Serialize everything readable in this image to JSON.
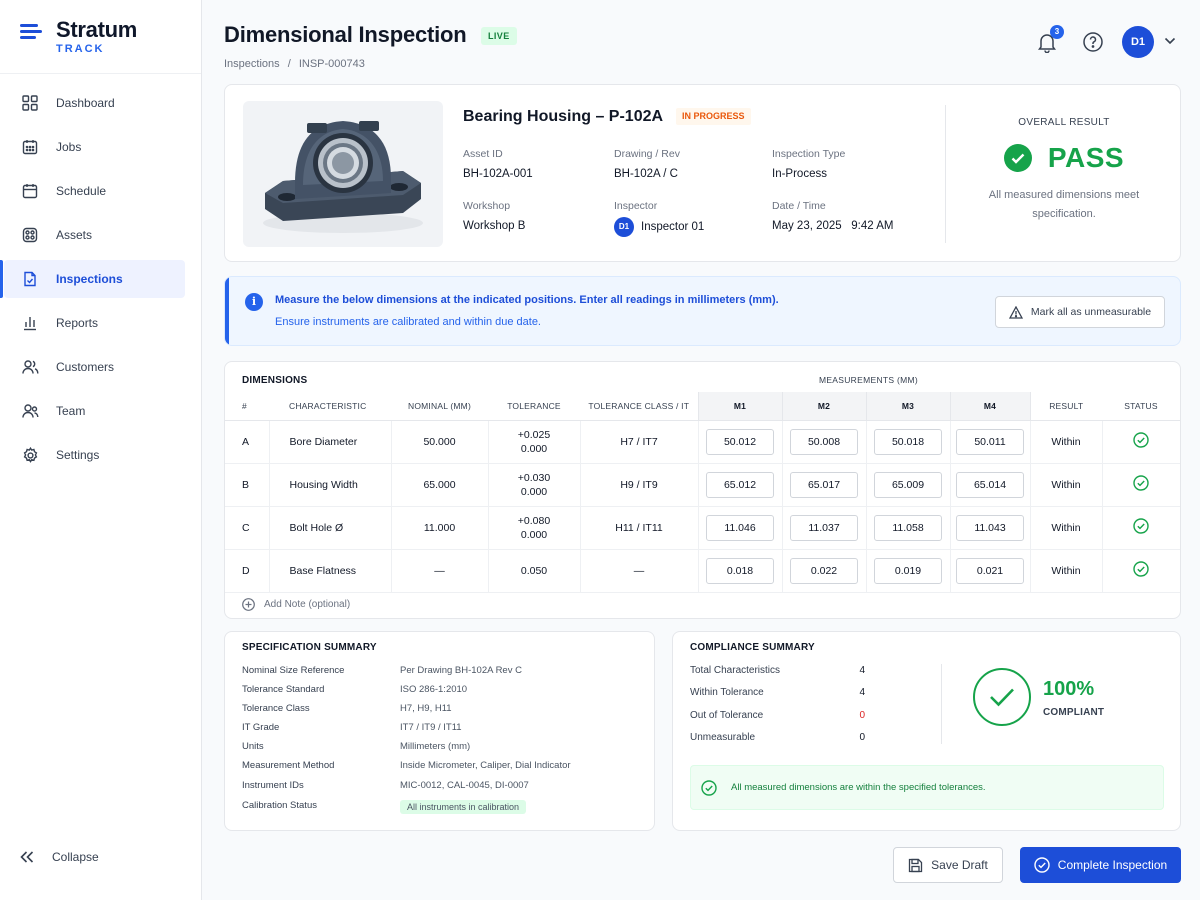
{
  "brand": {
    "name": "Stratum",
    "sub": "TRACK"
  },
  "nav": [
    {
      "label": "Dashboard",
      "icon": "grid-icon"
    },
    {
      "label": "Jobs",
      "icon": "calendar-grid-icon"
    },
    {
      "label": "Schedule",
      "icon": "calendar-icon"
    },
    {
      "label": "Assets",
      "icon": "assets-icon"
    },
    {
      "label": "Inspections",
      "icon": "clipboard-check-icon",
      "active": true
    },
    {
      "label": "Reports",
      "icon": "bar-chart-icon"
    },
    {
      "label": "Customers",
      "icon": "users-icon"
    },
    {
      "label": "Team",
      "icon": "team-icon"
    },
    {
      "label": "Settings",
      "icon": "gear-icon"
    }
  ],
  "collapse_label": "Collapse",
  "header": {
    "title": "Dimensional Inspection",
    "badge": "LIVE",
    "breadcrumb": [
      "Inspections",
      "/",
      "INSP-000743"
    ],
    "notifications": "3",
    "avatar": "D1"
  },
  "asset": {
    "title": "Bearing Housing – P-102A",
    "status": "IN PROGRESS",
    "fields": {
      "asset_id_label": "Asset ID",
      "asset_id": "BH-102A-001",
      "drawing_label": "Drawing / Rev",
      "drawing": "BH-102A / C",
      "type_label": "Inspection Type",
      "type": "In-Process",
      "workshop_label": "Workshop",
      "workshop": "Workshop B",
      "inspector_label": "Inspector",
      "inspector": "Inspector 01",
      "inspector_initials": "D1",
      "datetime_label": "Date / Time",
      "datetime": "May 23, 2025   9:42 AM"
    },
    "overall_label": "OVERALL RESULT",
    "overall_result": "PASS",
    "overall_note": "All measured dimensions meet specification."
  },
  "info": {
    "line1": "Measure the below dimensions at the indicated positions. Enter all readings in millimeters (mm).",
    "line2": "Ensure instruments are calibrated and within due date.",
    "button": "Mark all as unmeasurable"
  },
  "dimensions": {
    "title": "DIMENSIONS",
    "measurements_title": "MEASUREMENTS (MM)",
    "headers": [
      "#",
      "CHARACTERISTIC",
      "NOMINAL (MM)",
      "TOLERANCE",
      "TOLERANCE CLASS / IT",
      "M1",
      "M2",
      "M3",
      "M4",
      "RESULT",
      "STATUS"
    ],
    "rows": [
      {
        "id": "A",
        "name": "Bore Diameter",
        "nominal": "50.000",
        "tol_upper": "+0.025",
        "tol_lower": "0.000",
        "tclass": "H7 / IT7",
        "m": [
          "50.012",
          "50.008",
          "50.018",
          "50.011"
        ],
        "result": "Within"
      },
      {
        "id": "B",
        "name": "Housing Width",
        "nominal": "65.000",
        "tol_upper": "+0.030",
        "tol_lower": "0.000",
        "tclass": "H9 / IT9",
        "m": [
          "65.012",
          "65.017",
          "65.009",
          "65.014"
        ],
        "result": "Within"
      },
      {
        "id": "C",
        "name": "Bolt Hole Ø",
        "nominal": "11.000",
        "tol_upper": "+0.080",
        "tol_lower": "0.000",
        "tclass": "H11 / IT11",
        "m": [
          "11.046",
          "11.037",
          "11.058",
          "11.043"
        ],
        "result": "Within"
      },
      {
        "id": "D",
        "name": "Base Flatness",
        "nominal": "—",
        "tol_upper": "0.050",
        "tol_lower": "",
        "tclass": "—",
        "m": [
          "0.018",
          "0.022",
          "0.019",
          "0.021"
        ],
        "result": "Within"
      }
    ],
    "add_note": "Add Note (optional)"
  },
  "spec": {
    "title": "SPECIFICATION SUMMARY",
    "rows": [
      {
        "k": "Nominal Size Reference",
        "v": "Per Drawing BH-102A Rev C"
      },
      {
        "k": "Tolerance Standard",
        "v": "ISO 286-1:2010"
      },
      {
        "k": "Tolerance Class",
        "v": "H7, H9, H11"
      },
      {
        "k": "IT Grade",
        "v": "IT7 / IT9 / IT11"
      },
      {
        "k": "Units",
        "v": "Millimeters (mm)"
      },
      {
        "k": "Measurement Method",
        "v": "Inside Micrometer, Caliper, Dial Indicator"
      },
      {
        "k": "Instrument IDs",
        "v": "MIC-0012, CAL-0045, DI-0007"
      },
      {
        "k": "Calibration Status",
        "v": "All instruments in calibration"
      }
    ]
  },
  "compliance": {
    "title": "COMPLIANCE SUMMARY",
    "rows": [
      {
        "k": "Total Characteristics",
        "v": "4"
      },
      {
        "k": "Within Tolerance",
        "v": "4"
      },
      {
        "k": "Out of Tolerance",
        "v": "0"
      },
      {
        "k": "Unmeasurable",
        "v": "0"
      }
    ],
    "percent": "100%",
    "percent_label": "COMPLIANT",
    "note": "All measured dimensions are within the specified tolerances."
  },
  "actions": {
    "draft": "Save Draft",
    "complete": "Complete Inspection"
  },
  "colors": {
    "accent": "#1d4ed8",
    "pass": "#16a34a",
    "warn": "#ea580c",
    "danger": "#dc2626"
  }
}
